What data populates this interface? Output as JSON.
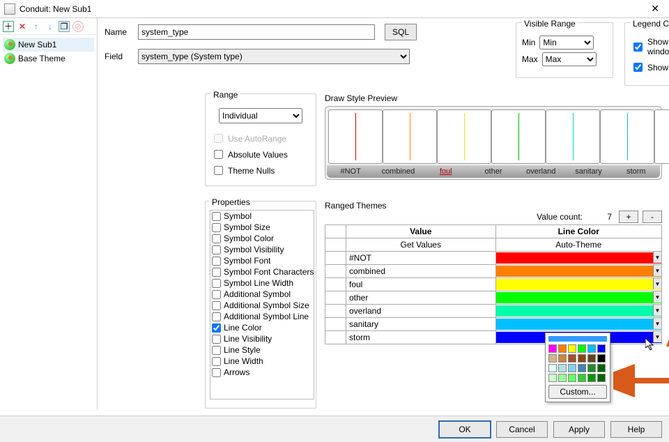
{
  "title": "Conduit: New Sub1",
  "tree": {
    "items": [
      "New Sub1",
      "Base Theme"
    ]
  },
  "labels": {
    "name": "Name",
    "field": "Field",
    "sql": "SQL",
    "visible_range": "Visible Range",
    "min": "Min",
    "max": "Max",
    "legend_control": "Legend Control",
    "show_thematic": "Show in Thematic Key window",
    "show_printed": "Show in Printed Legend",
    "range": "Range",
    "use_autorange": "Use AutoRange",
    "absolute_values": "Absolute Values",
    "theme_nulls": "Theme Nulls",
    "draw_style_preview": "Draw Style Preview",
    "properties": "Properties",
    "ranged_themes": "Ranged Themes",
    "value_count": "Value count:",
    "value": "Value",
    "line_color": "Line Color",
    "get_values": "Get Values",
    "auto_theme": "Auto-Theme",
    "custom": "Custom..."
  },
  "name_value": "system_type",
  "field_value": "system_type (System type)",
  "range_mode": "Individual",
  "vrange": {
    "min": "Min",
    "max": "Max"
  },
  "value_count": "7",
  "preview_items": [
    {
      "label": "#NOT",
      "color": "#d00000"
    },
    {
      "label": "combined",
      "color": "#ff8c00"
    },
    {
      "label": "foul",
      "color": "#e8e800"
    },
    {
      "label": "other",
      "color": "#00c000"
    },
    {
      "label": "overland",
      "color": "#00d8b0"
    },
    {
      "label": "sanitary",
      "color": "#00b8ff"
    },
    {
      "label": "storm",
      "color": "#0030ff"
    }
  ],
  "properties": [
    {
      "label": "Symbol",
      "checked": false
    },
    {
      "label": "Symbol Size",
      "checked": false
    },
    {
      "label": "Symbol Color",
      "checked": false
    },
    {
      "label": "Symbol Visibility",
      "checked": false
    },
    {
      "label": "Symbol Font",
      "checked": false
    },
    {
      "label": "Symbol Font Characters",
      "checked": false
    },
    {
      "label": "Symbol Line Width",
      "checked": false
    },
    {
      "label": "Additional Symbol",
      "checked": false
    },
    {
      "label": "Additional Symbol Size",
      "checked": false
    },
    {
      "label": "Additional Symbol Line",
      "checked": false
    },
    {
      "label": "Line Color",
      "checked": true
    },
    {
      "label": "Line Visibility",
      "checked": false
    },
    {
      "label": "Line Style",
      "checked": false
    },
    {
      "label": "Line Width",
      "checked": false
    },
    {
      "label": "Arrows",
      "checked": false
    }
  ],
  "rows": [
    {
      "value": "#NOT",
      "color": "#ff0000"
    },
    {
      "value": "combined",
      "color": "#ff8000"
    },
    {
      "value": "foul",
      "color": "#ffff00"
    },
    {
      "value": "other",
      "color": "#00ff00"
    },
    {
      "value": "overland",
      "color": "#00ffaa"
    },
    {
      "value": "sanitary",
      "color": "#00c0ff"
    },
    {
      "value": "storm",
      "color": "#0000ff"
    }
  ],
  "picker_colors": [
    "#ff00ff",
    "#ff8000",
    "#ffff00",
    "#00ff00",
    "#00c0ff",
    "#0000ff",
    "#d2b48c",
    "#cd853f",
    "#a0522d",
    "#8b4513",
    "#654321",
    "#000000",
    "#e0ffff",
    "#b0e0e6",
    "#87ceeb",
    "#4682b4",
    "#228b22",
    "#006400",
    "#ccffcc",
    "#99ff99",
    "#66ff66",
    "#33cc33",
    "#009900",
    "#006600"
  ],
  "footer": {
    "ok": "OK",
    "cancel": "Cancel",
    "apply": "Apply",
    "help": "Help"
  }
}
